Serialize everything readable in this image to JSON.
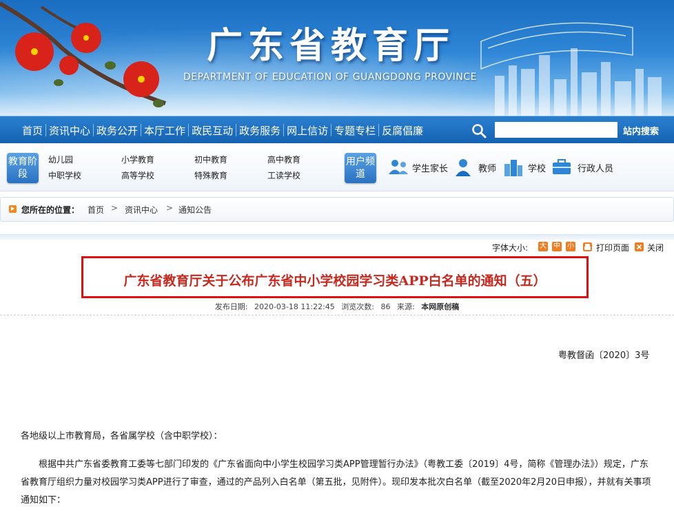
{
  "header": {
    "title": "广东省教育厅",
    "subtitle": "DEPARTMENT OF EDUCATION OF GUANGDONG PROVINCE"
  },
  "nav": {
    "items": [
      "首页",
      "资讯中心",
      "政务公开",
      "本厅工作",
      "政民互动",
      "政务服务",
      "网上信访",
      "专题专栏",
      "反腐倡廉"
    ],
    "search_placeholder": "",
    "search_button": "站内搜索"
  },
  "channels": {
    "stage_badge": "教育阶段",
    "stages": [
      "幼儿园",
      "中职学校",
      "小学教育",
      "高等学校",
      "初中教育",
      "特殊教育",
      "高中教育",
      "工读学校"
    ],
    "user_badge": "用户频道",
    "users": [
      "学生家长",
      "教师",
      "学校",
      "行政人员"
    ]
  },
  "breadcrumb": {
    "label": "您所在的位置：",
    "items": [
      "首页",
      "资讯中心",
      "通知公告"
    ],
    "sep": ">"
  },
  "tools": {
    "font_size_label": "字体大小:",
    "sizes": [
      "大",
      "中",
      "小"
    ],
    "print": "打印页面",
    "close": "关闭"
  },
  "article": {
    "title": "广东省教育厅关于公布广东省中小学校园学习类APP白名单的通知（五）",
    "meta": {
      "date_label": "发布日期:",
      "date": "2020-03-18 11:22:45",
      "views_label": "浏览次数:",
      "views": "86",
      "source_label": "来源:",
      "source": "本网原创稿"
    },
    "doc_number": "粤教督函〔2020〕3号",
    "salutation": "各地级以上市教育局，各省属学校（含中职学校）：",
    "paragraph": "根据中共广东省委教育工委等七部门印发的《广东省面向中小学生校园学习类APP管理暂行办法》（粤教工委〔2019〕4号，简称《管理办法》）规定，广东省教育厅组织力量对校园学习类APP进行了审查，通过的产品列入白名单（第五批，见附件）。现印发本批次白名单（截至2020年2月20日申报），并就有关事项通知如下："
  },
  "colors": {
    "nav_bg": "#1a6dc1",
    "headline_red": "#c8281e",
    "highlight_box": "#e01010",
    "accent_orange": "#f07d22"
  }
}
